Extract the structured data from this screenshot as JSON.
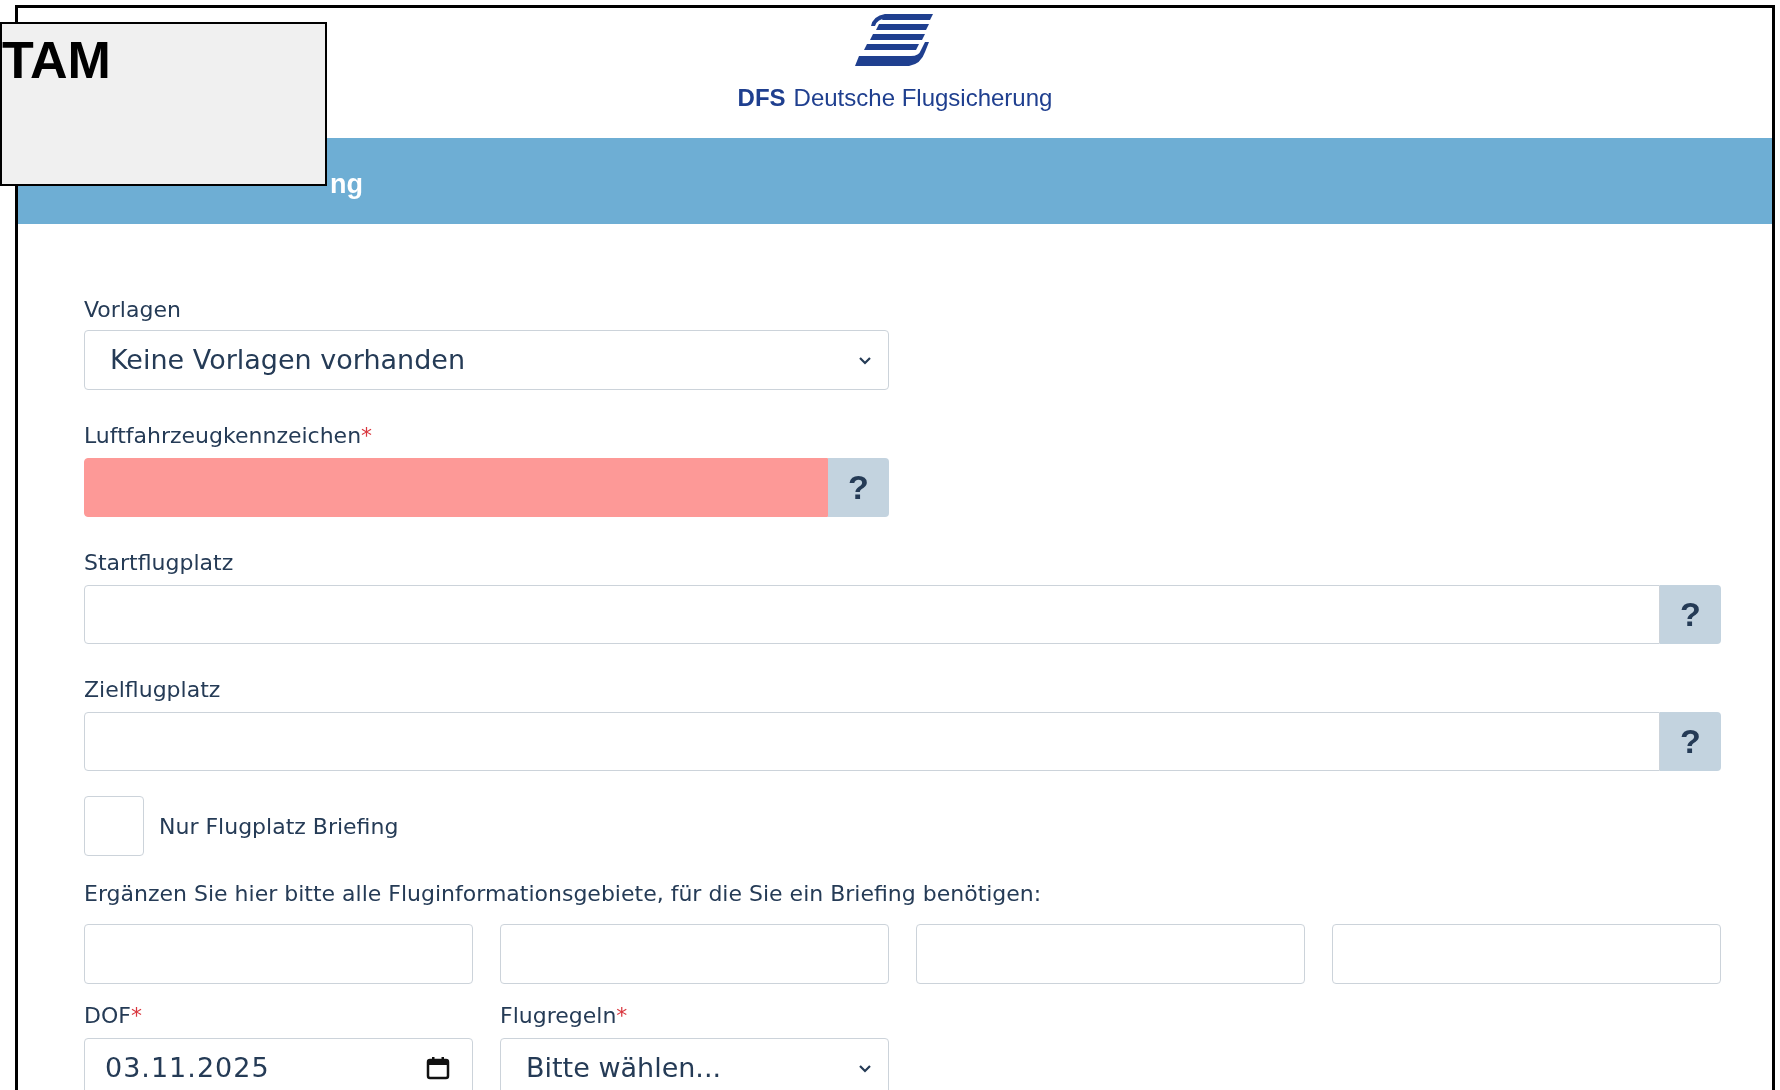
{
  "overlay_label": "TAM",
  "logo": {
    "brand": "DFS",
    "name": "Deutsche Flugsicherung"
  },
  "heading": "ng",
  "template": {
    "label": "Vorlagen",
    "value": "Keine Vorlagen vorhanden"
  },
  "registration": {
    "label": "Luftfahrzeugkennzeichen",
    "required_mark": "*",
    "invalid": true,
    "help": "?"
  },
  "departure": {
    "label": "Startflugplatz",
    "invalid": false,
    "help": "?"
  },
  "destination": {
    "label": "Zielflugplatz",
    "invalid": false,
    "help": "?"
  },
  "aerodrome_only": {
    "label": "Nur Flugplatz Briefing",
    "checked": false
  },
  "fir": {
    "prompt": "Ergänzen Sie hier bitte alle Fluginformationsgebiete, für die Sie ein Briefing benötigen:",
    "fields": [
      {
        "invalid": false
      },
      {
        "invalid": false
      },
      {
        "invalid": false
      },
      {
        "invalid": false
      }
    ]
  },
  "dof": {
    "label": "DOF",
    "required_mark": "*",
    "value": "03.11.2025"
  },
  "flight_rules": {
    "label": "Flugregeln",
    "required_mark": "*",
    "value": "Bitte wählen..."
  }
}
